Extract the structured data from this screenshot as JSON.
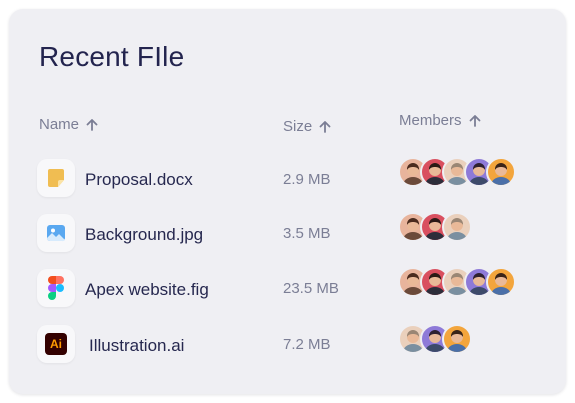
{
  "title": "Recent FIle",
  "columns": {
    "name": "Name",
    "size": "Size",
    "members": "Members"
  },
  "files": [
    {
      "name": "Proposal.docx",
      "size": "2.9 MB",
      "icon": "document-note-icon",
      "members": [
        "avatar-brown",
        "avatar-red",
        "avatar-beige",
        "avatar-purple",
        "avatar-orange"
      ]
    },
    {
      "name": "Background.jpg",
      "size": "3.5 MB",
      "icon": "image-icon",
      "members": [
        "avatar-brown",
        "avatar-red",
        "avatar-beige"
      ]
    },
    {
      "name": "Apex website.fig",
      "size": "23.5 MB",
      "icon": "figma-icon",
      "members": [
        "avatar-brown",
        "avatar-red",
        "avatar-beige",
        "avatar-purple",
        "avatar-orange"
      ]
    },
    {
      "name": "Illustration.ai",
      "size": "7.2 MB",
      "icon": "illustrator-icon",
      "icon_text": "Ai",
      "members": [
        "avatar-beige",
        "avatar-purple",
        "avatar-orange"
      ]
    }
  ],
  "colors": {
    "card_background": "#efeff3",
    "title": "#23244e",
    "muted_text": "#7b7e95",
    "avatar_brown": "#e8b49c",
    "avatar_red": "#d94f5f",
    "avatar_beige": "#ead0bc",
    "avatar_purple": "#8e7ad8",
    "avatar_orange": "#f3a53c"
  }
}
